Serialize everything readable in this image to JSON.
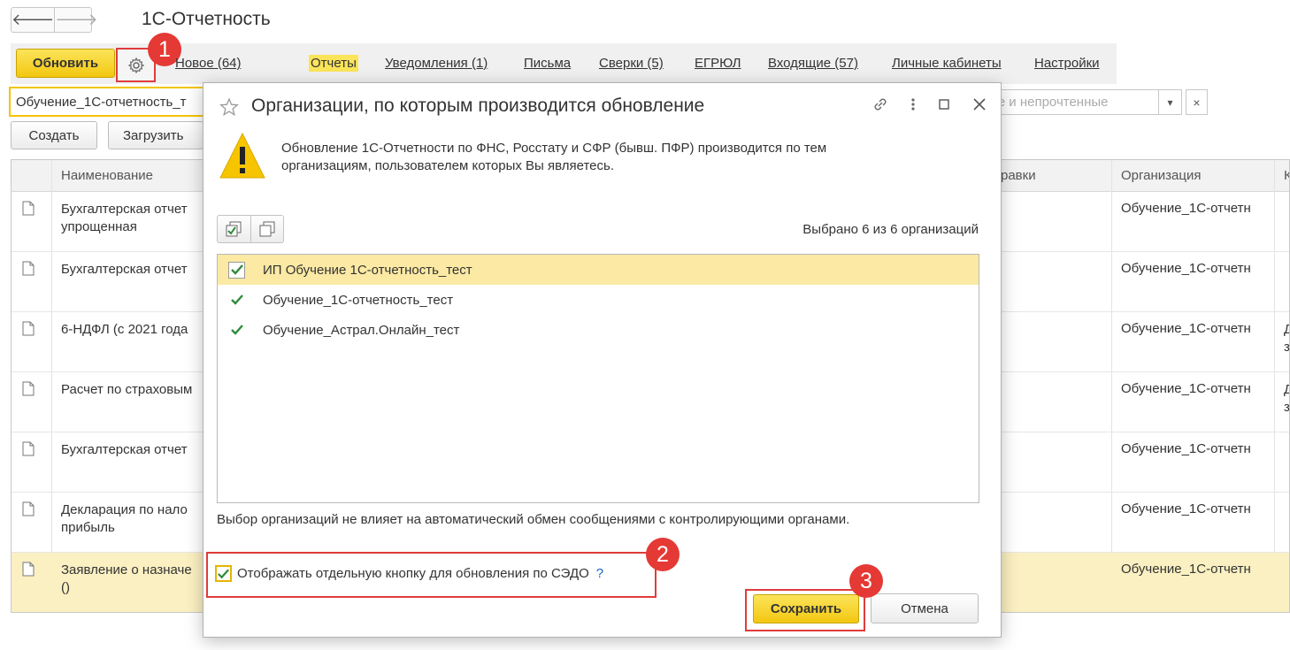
{
  "app": {
    "title": "1С-Отчетность"
  },
  "nav": {
    "back_icon": "arrow-left",
    "forward_icon": "arrow-right"
  },
  "toolbar": {
    "refresh_label": "Обновить",
    "settings_icon": "gear-icon",
    "new_link": "Новое (64)",
    "tabs": [
      {
        "label": "Отчеты",
        "active": true
      },
      {
        "label": "Уведомления (1)"
      },
      {
        "label": "Письма"
      },
      {
        "label": "Сверки (5)"
      },
      {
        "label": "ЕГРЮЛ"
      },
      {
        "label": "Входящие (57)"
      },
      {
        "label": "Личные кабинеты"
      },
      {
        "label": "Настройки"
      }
    ]
  },
  "filter": {
    "org_value": "Обучение_1С-отчетность_т",
    "status_placeholder": "ые и непрочтенные",
    "dropdown_icon": "▾",
    "clear_icon": "×"
  },
  "actions": {
    "create_label": "Создать",
    "load_label": "Загрузить"
  },
  "table": {
    "columns": [
      "Наименование",
      "равки",
      "Организация",
      "К"
    ],
    "rows": [
      {
        "name": "Бухгалтерская отчет\nупрощенная",
        "org": "Обучение_1С-отчетн",
        "extra": ""
      },
      {
        "name": "Бухгалтерская отчет",
        "org": "Обучение_1С-отчетн",
        "extra": ""
      },
      {
        "name": "6-НДФЛ (с 2021 года",
        "org": "Обучение_1С-отчетн",
        "extra": "Д\nз"
      },
      {
        "name": "Расчет по страховым",
        "org": "Обучение_1С-отчетн",
        "extra": "Д\nз"
      },
      {
        "name": "Бухгалтерская отчет",
        "org": "Обучение_1С-отчетн",
        "extra": ""
      },
      {
        "name": "Декларация по нало\nприбыль",
        "org": "Обучение_1С-отчетн",
        "extra": ""
      },
      {
        "name": "Заявление о назначе\n()",
        "org": "Обучение_1С-отчетн",
        "extra": "",
        "selected": true
      }
    ]
  },
  "dialog": {
    "title": "Организации, по которым производится обновление",
    "warning": "Обновление 1С-Отчетности по ФНС, Росстату и СФР (бывш. ПФР) производится по тем организациям, пользователем которых Вы являетесь.",
    "selected_count": "Выбрано 6 из 6 организаций",
    "organizations": [
      {
        "name": "ИП Обучение 1С-отчетность_тест",
        "checked": true,
        "selected": true
      },
      {
        "name": "Обучение_1С-отчетность_тест",
        "checked": true
      },
      {
        "name": "Обучение_Астрал.Онлайн_тест",
        "checked": true
      }
    ],
    "note": "Выбор организаций не влияет на автоматический обмен сообщениями с контролирующими органами.",
    "sedo_checkbox_label": "Отображать отдельную кнопку для обновления по СЭДО",
    "help_mark": "?",
    "save_label": "Сохранить",
    "cancel_label": "Отмена"
  },
  "markers": [
    "1",
    "2",
    "3"
  ],
  "colors": {
    "accent_yellow": "#F3C710",
    "highlight": "#FBE9A4",
    "marker_red": "#E53935",
    "check_green": "#2E8B3A"
  }
}
